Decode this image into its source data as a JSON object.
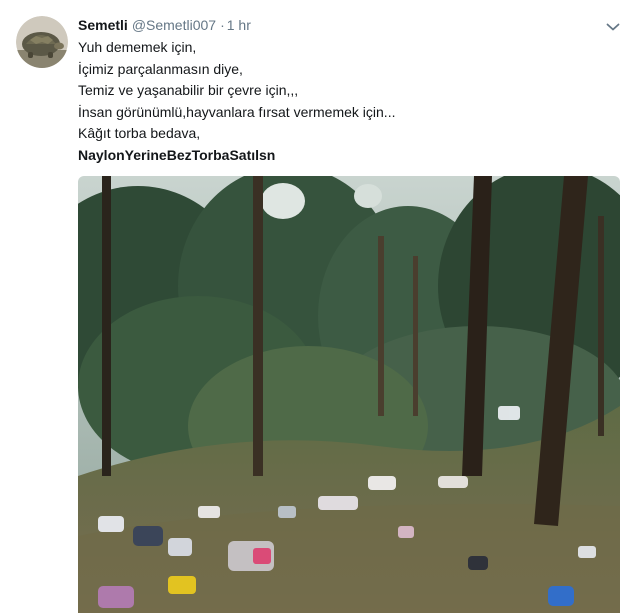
{
  "tweet": {
    "author_name": "Semetli",
    "handle": "@Semetli007",
    "separator": "·",
    "timestamp": "1 hr",
    "lines": [
      "Yuh dememek için,",
      "İçimiz parçalanmasın diye,",
      "Temiz ve yaşanabilir bir çevre için,,,",
      "İnsan görünümlü,hayvanlara fırsat vermemek için...",
      "Kâğıt torba bedava,"
    ],
    "hashtag": "NaylonYerineBezTorbaSatılsn",
    "avatar_icon": "tortoise-avatar",
    "menu_icon": "chevron-down-icon",
    "media_description": "forest-photo"
  },
  "colors": {
    "text": "#14171a",
    "secondary": "#657786",
    "caret": "#657786"
  }
}
